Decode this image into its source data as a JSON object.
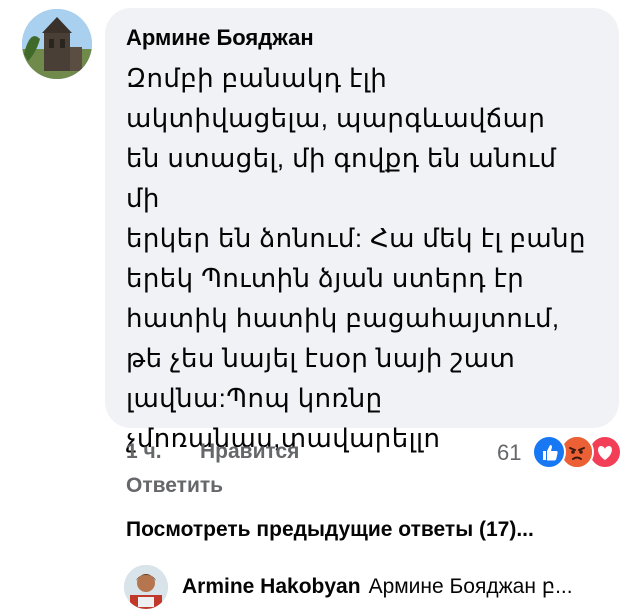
{
  "comment": {
    "author": "Армине Бояджан",
    "text": "Զոմբի բանակդ էլի\nակտիվացելա, պարգևավճար\nեն ստացել, մի գովքդ են անում մի\nերկեր են ձոնում: Հա մեկ էլ բանը\nերեկ Պուտին ձյան ստերդ էր\nհատիկ հատիկ բացահայտում,\nթե չես նայել էսօր նայի շատ\nլավնա:Պոպ կոռնը\nչմոռանաս,տավարելլո",
    "time": "1 ч.",
    "like_label": "Нравится",
    "reply_label": "Ответить",
    "reaction_count": "61",
    "reactions": [
      "like-reaction-icon",
      "angry-reaction-icon",
      "love-reaction-icon"
    ]
  },
  "previous_replies_label": "Посмотреть предыдущие ответы (17)...",
  "reply": {
    "author": "Armine Hakobyan",
    "preview": "Армине Бояджан բ..."
  },
  "colors": {
    "bubble": "#f0f2f5",
    "meta": "#65676b",
    "like": "#1877f2",
    "angry": "#f0633a",
    "love": "#f33e58"
  }
}
